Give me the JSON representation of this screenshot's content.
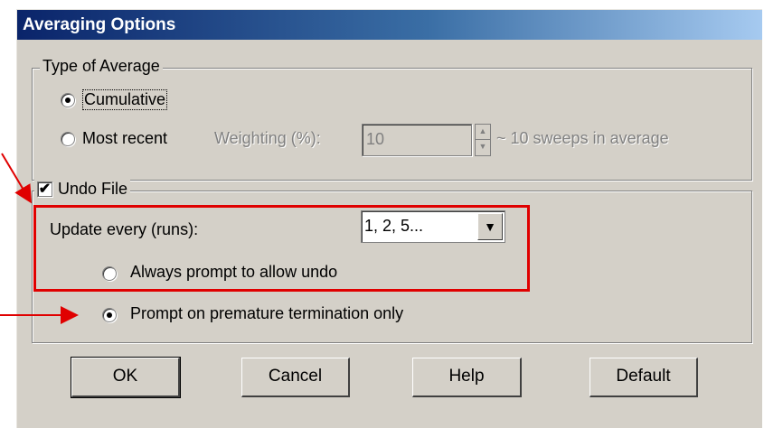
{
  "window": {
    "title": "Averaging Options"
  },
  "type_of_average": {
    "legend": "Type of Average",
    "cumulative_label": "Cumulative",
    "most_recent_label": "Most recent",
    "weighting_label": "Weighting (%):",
    "weighting_value": "10",
    "sweeps_text": "~ 10 sweeps in average",
    "selected": "cumulative"
  },
  "undo_file": {
    "legend": "Undo File",
    "checked": true,
    "update_label": "Update every (runs):",
    "update_value": "1, 2, 5...",
    "always_prompt_label": "Always prompt to allow undo",
    "premature_label": "Prompt on premature termination only",
    "selected": "premature"
  },
  "buttons": {
    "ok": "OK",
    "cancel": "Cancel",
    "help": "Help",
    "default": "Default"
  },
  "colors": {
    "annotation": "#e00000",
    "title_bar": "#0a246a",
    "dialog_bg": "#d4d0c8"
  }
}
